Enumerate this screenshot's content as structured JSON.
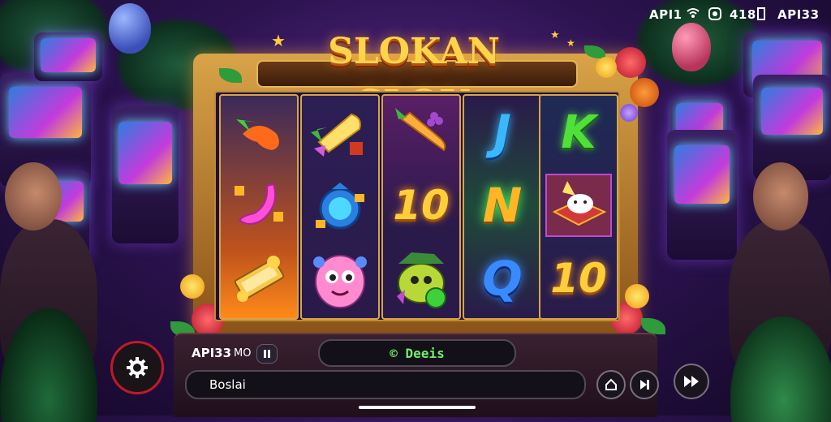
{
  "status_bar": {
    "left_text": "API1",
    "battery_text": "418",
    "right_text": "API33"
  },
  "game": {
    "title": "SLOKAN SLOU",
    "reels": [
      [
        {
          "name": "pepper",
          "text": ""
        },
        {
          "name": "banana",
          "text": ""
        },
        {
          "name": "gold-bars",
          "text": ""
        }
      ],
      [
        {
          "name": "pineapple",
          "text": ""
        },
        {
          "name": "coin-bag",
          "text": ""
        },
        {
          "name": "pink-monster",
          "text": ""
        }
      ],
      [
        {
          "name": "carrot",
          "text": ""
        },
        {
          "name": "ten",
          "text": "10"
        },
        {
          "name": "green-monster",
          "text": ""
        }
      ],
      [
        {
          "name": "j",
          "text": "J"
        },
        {
          "name": "n",
          "text": "N"
        },
        {
          "name": "q",
          "text": "Q"
        }
      ],
      [
        {
          "name": "k",
          "text": "K"
        },
        {
          "name": "gift-box",
          "text": ""
        },
        {
          "name": "ten",
          "text": "10"
        }
      ]
    ]
  },
  "console": {
    "bet_label": "API33",
    "bet_unit": "MO",
    "balance_text": "© Deeis",
    "input_value": "Boslai"
  },
  "colors": {
    "accent_gold": "#ffd44a",
    "reel_bg": "#1d1140",
    "balance_green": "#6cf06a"
  }
}
